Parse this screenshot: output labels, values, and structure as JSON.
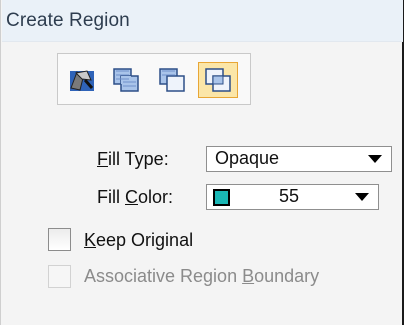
{
  "window": {
    "title": "Create Region"
  },
  "toolbar": {
    "tools": [
      {
        "icon": "flood-fill-icon",
        "active": false
      },
      {
        "icon": "union-regions-icon",
        "active": false
      },
      {
        "icon": "difference-regions-icon",
        "active": false
      },
      {
        "icon": "intersection-regions-icon",
        "active": true
      }
    ]
  },
  "fill_type": {
    "label_pre": "",
    "label_mnemonic": "F",
    "label_post": "ill Type:",
    "value": "Opaque"
  },
  "fill_color": {
    "label_pre": "Fill ",
    "label_mnemonic": "C",
    "label_post": "olor:",
    "value": "55",
    "swatch_color": "#1ab7b5"
  },
  "keep_original": {
    "label_pre": "",
    "label_mnemonic": "K",
    "label_post": "eep Original",
    "checked": false,
    "enabled": true
  },
  "assoc_boundary": {
    "label_pre": "Associative Region ",
    "label_mnemonic": "B",
    "label_post": "oundary",
    "checked": false,
    "enabled": false
  }
}
